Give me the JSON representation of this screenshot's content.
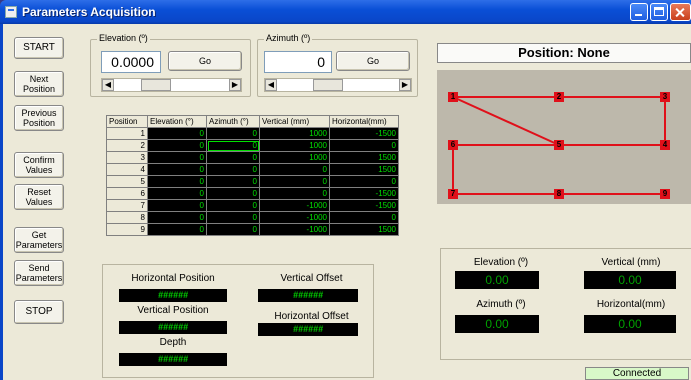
{
  "window": {
    "title": "Parameters Acquisition"
  },
  "left_buttons": {
    "start": "START",
    "next_position": "Next\nPosition",
    "previous_position": "Previous\nPosition",
    "confirm_values": "Confirm\nValues",
    "reset_values": "Reset\nValues",
    "get_parameters": "Get\nParameters",
    "send_parameters": "Send\nParameters",
    "stop": "STOP"
  },
  "elevation": {
    "label": "Elevation (º)",
    "value": "0.0000",
    "go_label": "Go"
  },
  "azimuth": {
    "label": "Azimuth (º)",
    "value": "0",
    "go_label": "Go"
  },
  "table": {
    "headers": [
      "Position",
      "Elevation (°)",
      "Azimuth (°)",
      "Vertical (mm)",
      "Horizontal(mm)"
    ],
    "rows": [
      [
        "1",
        "0",
        "0",
        "1000",
        "-1500"
      ],
      [
        "2",
        "0",
        "0",
        "1000",
        "0"
      ],
      [
        "3",
        "0",
        "0",
        "1000",
        "1500"
      ],
      [
        "4",
        "0",
        "0",
        "0",
        "1500"
      ],
      [
        "5",
        "0",
        "0",
        "0",
        "0"
      ],
      [
        "6",
        "0",
        "0",
        "0",
        "-1500"
      ],
      [
        "7",
        "0",
        "0",
        "-1000",
        "-1500"
      ],
      [
        "8",
        "0",
        "0",
        "-1000",
        "0"
      ],
      [
        "9",
        "0",
        "0",
        "-1000",
        "1500"
      ]
    ]
  },
  "offsets": {
    "horizontal_position_label": "Horizontal Position",
    "horizontal_position_value": "######",
    "vertical_position_label": "Vertical Position",
    "vertical_position_value": "######",
    "depth_label": "Depth",
    "depth_value": "######",
    "vertical_offset_label": "Vertical Offset",
    "vertical_offset_value": "######",
    "horizontal_offset_label": "Horizontal Offset",
    "horizontal_offset_value": "######"
  },
  "position": {
    "label": "Position: None"
  },
  "map_nodes": [
    "1",
    "2",
    "3",
    "4",
    "5",
    "6",
    "7",
    "8",
    "9"
  ],
  "readouts": {
    "elevation_label": "Elevation (º)",
    "elevation_value": "0.00",
    "vertical_label": "Vertical (mm)",
    "vertical_value": "0.00",
    "azimuth_label": "Azimuth (º)",
    "azimuth_value": "0.00",
    "horizontal_label": "Horizontal(mm)",
    "horizontal_value": "0.00"
  },
  "status": {
    "text": "Connected"
  },
  "colors": {
    "led_text": "#00d000",
    "map_line": "#e0101a",
    "map_bg": "#bdb8ab"
  }
}
